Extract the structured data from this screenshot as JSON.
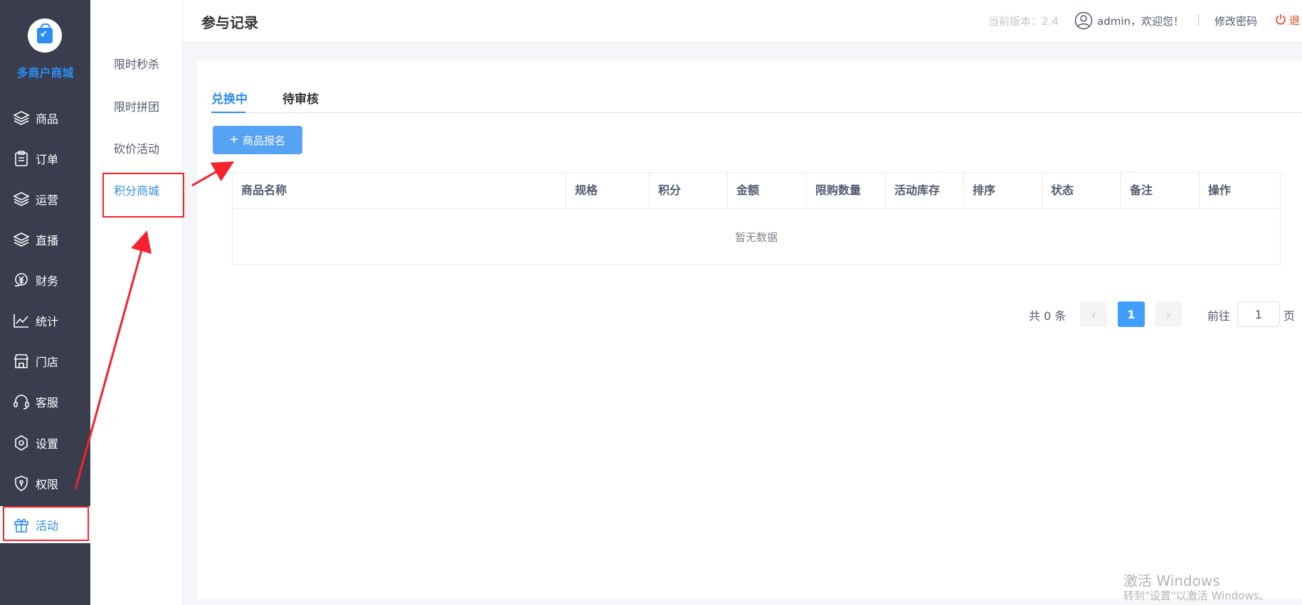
{
  "sidebar": {
    "brand": "多商户商城",
    "items": [
      {
        "label": "商品",
        "icon": "layers-icon"
      },
      {
        "label": "订单",
        "icon": "clipboard-icon"
      },
      {
        "label": "运营",
        "icon": "layers-icon"
      },
      {
        "label": "直播",
        "icon": "layers-icon"
      },
      {
        "label": "财务",
        "icon": "finance-icon"
      },
      {
        "label": "统计",
        "icon": "chart-line-icon"
      },
      {
        "label": "门店",
        "icon": "store-icon"
      },
      {
        "label": "客服",
        "icon": "headset-icon"
      },
      {
        "label": "设置",
        "icon": "gear-icon"
      },
      {
        "label": "权限",
        "icon": "shield-icon"
      },
      {
        "label": "活动",
        "icon": "gift-icon"
      }
    ]
  },
  "submenu": {
    "items": [
      "限时秒杀",
      "限时拼团",
      "砍价活动",
      "积分商城"
    ]
  },
  "header": {
    "title": "参与记录",
    "version": "当前版本：2.4",
    "user": "admin，欢迎您！",
    "separator": "|",
    "change_password": "修改密码",
    "logout": "退"
  },
  "tabs": [
    "兑换中",
    "待审核"
  ],
  "add_button": "商品报名",
  "table": {
    "columns": [
      "商品名称",
      "规格",
      "积分",
      "金额",
      "限购数量",
      "活动库存",
      "排序",
      "状态",
      "备注",
      "操作"
    ],
    "empty_text": "暂无数据"
  },
  "pagination": {
    "total": "共 0 条",
    "current": "1",
    "goto_label": "前往",
    "goto_value": "1",
    "page_suffix": "页"
  },
  "watermark": {
    "line1": "激活 Windows",
    "line2": "转到\"设置\"以激活 Windows。"
  },
  "colors": {
    "sidebar_bg": "#393d4d",
    "accent": "#2d8cf0",
    "annotation_red": "#f5222d"
  }
}
